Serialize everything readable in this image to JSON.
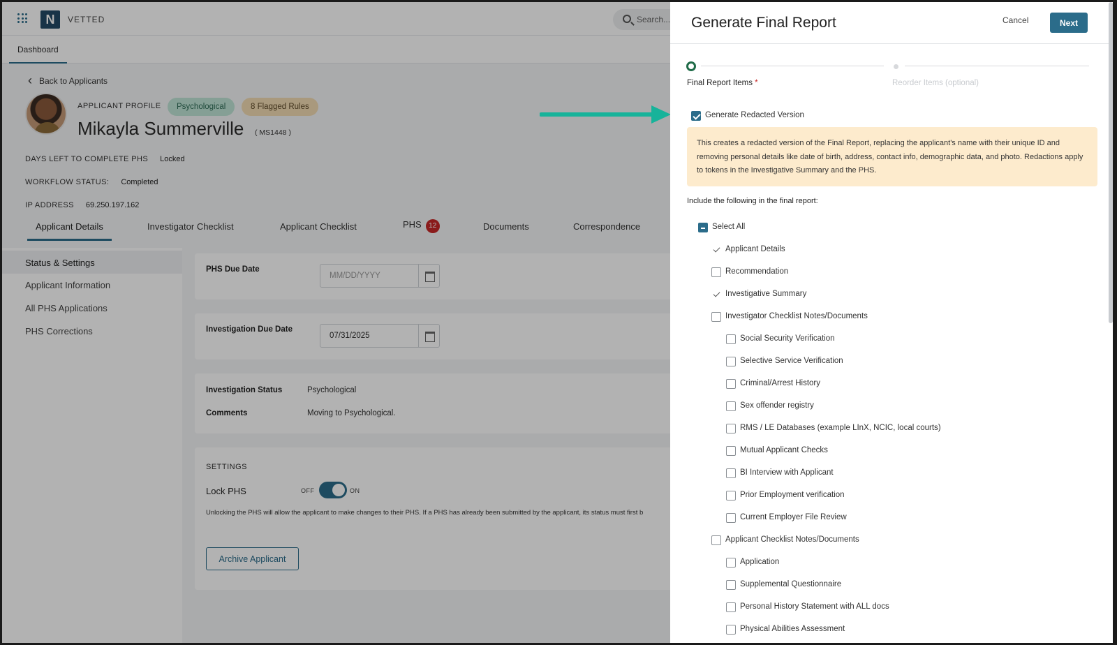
{
  "app": {
    "brand": "VETTED",
    "logo_letter": "N",
    "search_placeholder": "Search...",
    "nav_tab": "Dashboard"
  },
  "profile": {
    "back_label": "Back to Applicants",
    "section_label": "APPLICANT PROFILE",
    "badges": [
      "Psychological",
      "8 Flagged Rules"
    ],
    "name": "Mikayla Summerville",
    "id": "( MS1448 )",
    "meta": [
      {
        "key": "DAYS LEFT TO COMPLETE PHS",
        "value": "Locked"
      },
      {
        "key": "WORKFLOW STATUS:",
        "value": "Completed"
      },
      {
        "key": "IP ADDRESS",
        "value": "69.250.197.162"
      }
    ]
  },
  "tabs": [
    {
      "label": "Applicant Details",
      "active": true
    },
    {
      "label": "Investigator Checklist"
    },
    {
      "label": "Applicant Checklist"
    },
    {
      "label": "PHS",
      "count": "12"
    },
    {
      "label": "Documents"
    },
    {
      "label": "Correspondence"
    }
  ],
  "sidebar": {
    "items": [
      "Status & Settings",
      "Applicant Information",
      "All PHS Applications",
      "PHS Corrections"
    ]
  },
  "main": {
    "phs_due_label": "PHS Due Date",
    "phs_due_placeholder": "MM/DD/YYYY",
    "inv_due_label": "Investigation Due Date",
    "inv_due_value": "07/31/2025",
    "inv_status_label": "Investigation Status",
    "inv_status_value": "Psychological",
    "comments_label": "Comments",
    "comments_value": "Moving to Psychological.",
    "settings_title": "SETTINGS",
    "lock_label": "Lock PHS",
    "toggle_off": "OFF",
    "toggle_on": "ON",
    "unlock_text": "Unlocking the PHS will allow the applicant to make changes to their PHS. If a PHS has already been submitted by the applicant, its status must first b",
    "archive_label": "Archive Applicant"
  },
  "drawer": {
    "title": "Generate Final Report",
    "cancel": "Cancel",
    "next": "Next",
    "steps": [
      "Final Report Items",
      "Reorder Items (optional)"
    ],
    "required_mark": "*",
    "redacted_label": "Generate Redacted Version",
    "notice": "This creates a redacted version of the Final Report, replacing the applicant's name with their unique ID and removing personal details like date of birth, address, contact info, demographic data, and photo. Redactions apply to tokens in the Investigative Summary and the PHS.",
    "include_title": "Include the following in the final report:",
    "select_all": "Select All",
    "items": [
      {
        "label": "Applicant Details",
        "checked": true
      },
      {
        "label": "Recommendation",
        "checked": false
      },
      {
        "label": "Investigative Summary",
        "checked": true
      },
      {
        "label": "Investigator Checklist Notes/Documents",
        "checked": false
      },
      {
        "label": "Social Security Verification",
        "checked": false
      },
      {
        "label": "Selective Service Verification",
        "checked": false
      },
      {
        "label": "Criminal/Arrest History",
        "checked": false
      },
      {
        "label": "Sex offender registry",
        "checked": false
      },
      {
        "label": "RMS / LE Databases (example LInX, NCIC, local courts)",
        "checked": false
      },
      {
        "label": "Mutual Applicant Checks",
        "checked": false
      },
      {
        "label": "BI Interview with Applicant",
        "checked": false
      },
      {
        "label": "Prior Employment verification",
        "checked": false
      },
      {
        "label": "Current Employer File Review",
        "checked": false
      },
      {
        "label": "Applicant Checklist Notes/Documents",
        "checked": false
      },
      {
        "label": "Application",
        "checked": false
      },
      {
        "label": "Supplemental Questionnaire",
        "checked": false
      },
      {
        "label": "Personal History Statement with ALL docs",
        "checked": false
      },
      {
        "label": "Physical Abilities Assessment",
        "checked": false
      }
    ]
  },
  "colors": {
    "accent": "#2b6c8a",
    "step_active": "#1f6b48",
    "notice_bg": "#fdebcd",
    "annotation_arrow": "#17b39a",
    "badge_red": "#c62828"
  }
}
